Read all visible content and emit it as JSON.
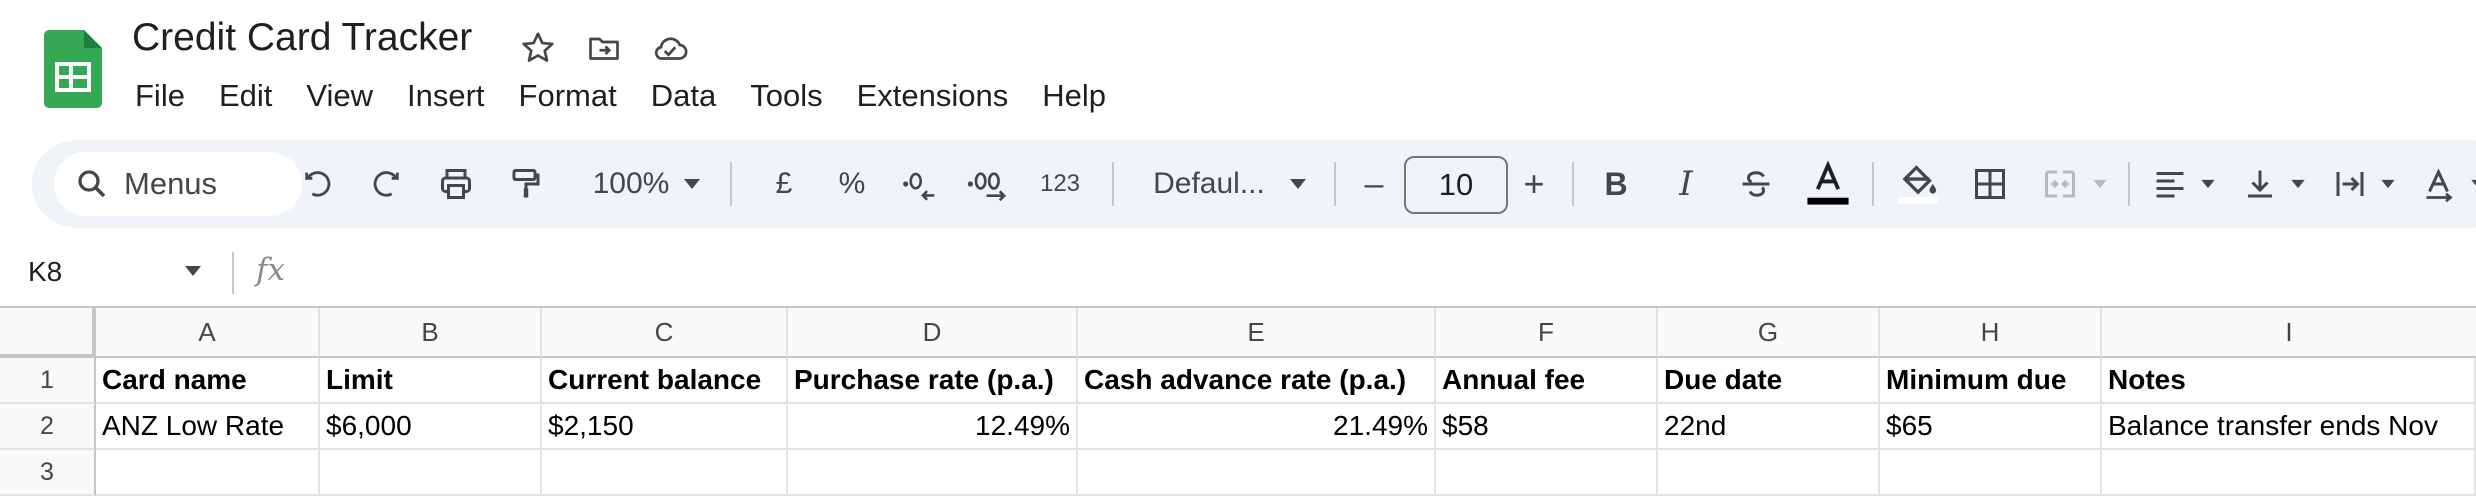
{
  "app": {
    "title": "Credit Card Tracker",
    "brand_color": "#34a853"
  },
  "menu": [
    "File",
    "Edit",
    "View",
    "Insert",
    "Format",
    "Data",
    "Tools",
    "Extensions",
    "Help"
  ],
  "toolbar": {
    "search_placeholder": "Menus",
    "zoom": "100%",
    "currency": "£",
    "percent": "%",
    "number_format": "123",
    "font": "Defaul...",
    "font_size": "10",
    "minus": "–",
    "plus": "+"
  },
  "formula_bar": {
    "cell_ref": "K8",
    "fx": "fx"
  },
  "sheet": {
    "columns": [
      "A",
      "B",
      "C",
      "D",
      "E",
      "F",
      "G",
      "H",
      "I"
    ],
    "row_numbers": [
      "1",
      "2",
      "3"
    ],
    "rows": [
      [
        "Card name",
        "Limit",
        "Current balance",
        "Purchase rate (p.a.)",
        "Cash advance rate (p.a.)",
        "Annual fee",
        "Due date",
        "Minimum due",
        "Notes"
      ],
      [
        "ANZ Low Rate",
        "$6,000",
        "$2,150",
        "12.49%",
        "21.49%",
        "$58",
        "22nd",
        "$65",
        "Balance transfer ends Nov"
      ],
      [
        "",
        "",
        "",
        "",
        "",
        "",
        "",
        "",
        ""
      ]
    ]
  }
}
